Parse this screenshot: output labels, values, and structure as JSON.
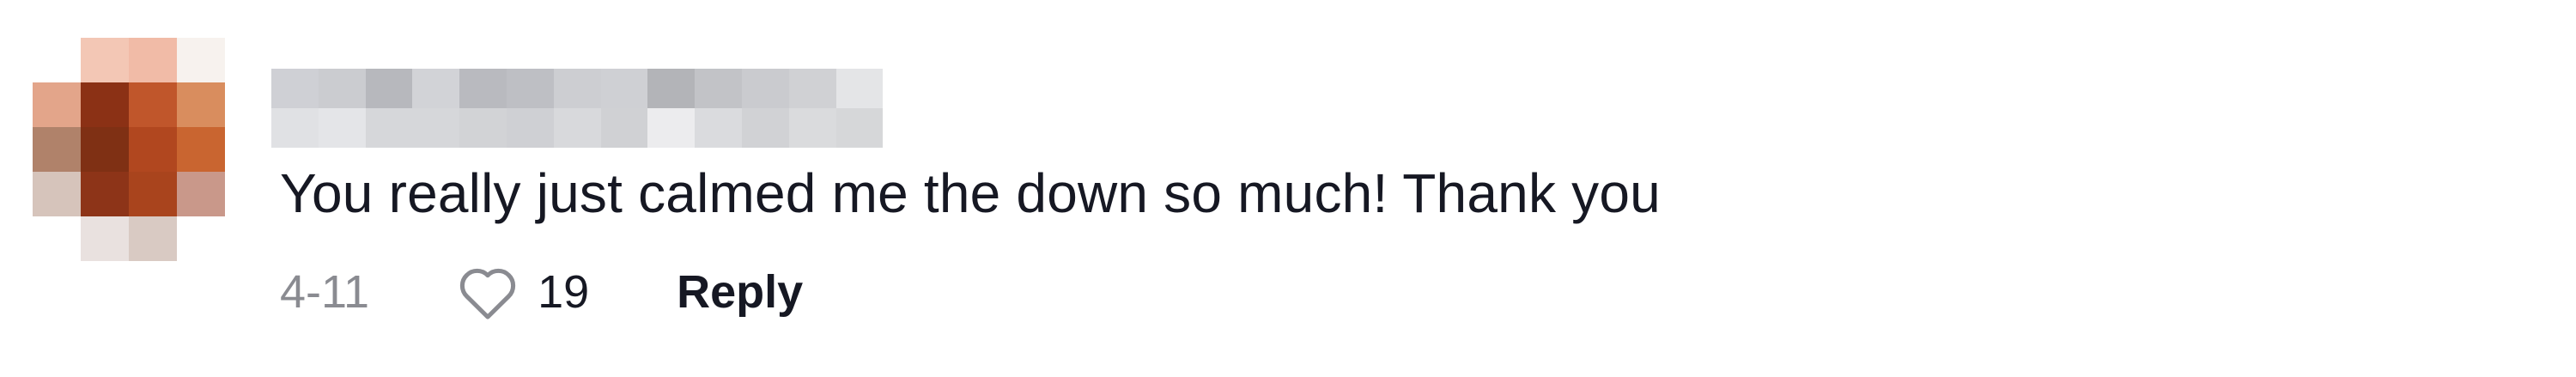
{
  "comment": {
    "text": "You really just calmed me the down so much! Thank you",
    "date": "4-11",
    "like_count": "19",
    "reply_label": "Reply",
    "avatar_blur_colors": [
      [
        "#ffffff",
        "#f3c7b5",
        "#f1bba7",
        "#f7f2ee"
      ],
      [
        "#e3a58a",
        "#8b3115",
        "#c0562b",
        "#d98d5e"
      ],
      [
        "#b0826a",
        "#7f3014",
        "#b1471f",
        "#c96530"
      ],
      [
        "#d6c4bb",
        "#8d3418",
        "#a9441d",
        "#c9988a"
      ],
      [
        "#ffffff",
        "#e9e1df",
        "#d9cac3",
        "#ffffff"
      ]
    ],
    "username_blur_colors": [
      [
        "#cfd0d5",
        "#cbccd0",
        "#b7b8bd",
        "#d2d3d7",
        "#b9babf",
        "#bebfc4",
        "#cdced2",
        "#cfd0d4",
        "#b3b4b8",
        "#c2c3c7",
        "#cacbcf",
        "#d0d1d4",
        "#e4e5e7"
      ],
      [
        "#e0e1e4",
        "#e4e5e8",
        "#d6d7da",
        "#d6d7da",
        "#d2d3d6",
        "#cfd0d4",
        "#d8d9dc",
        "#d0d1d4",
        "#ececee",
        "#dadbde",
        "#d1d2d5",
        "#dadbdd",
        "#d6d7d9"
      ]
    ]
  }
}
